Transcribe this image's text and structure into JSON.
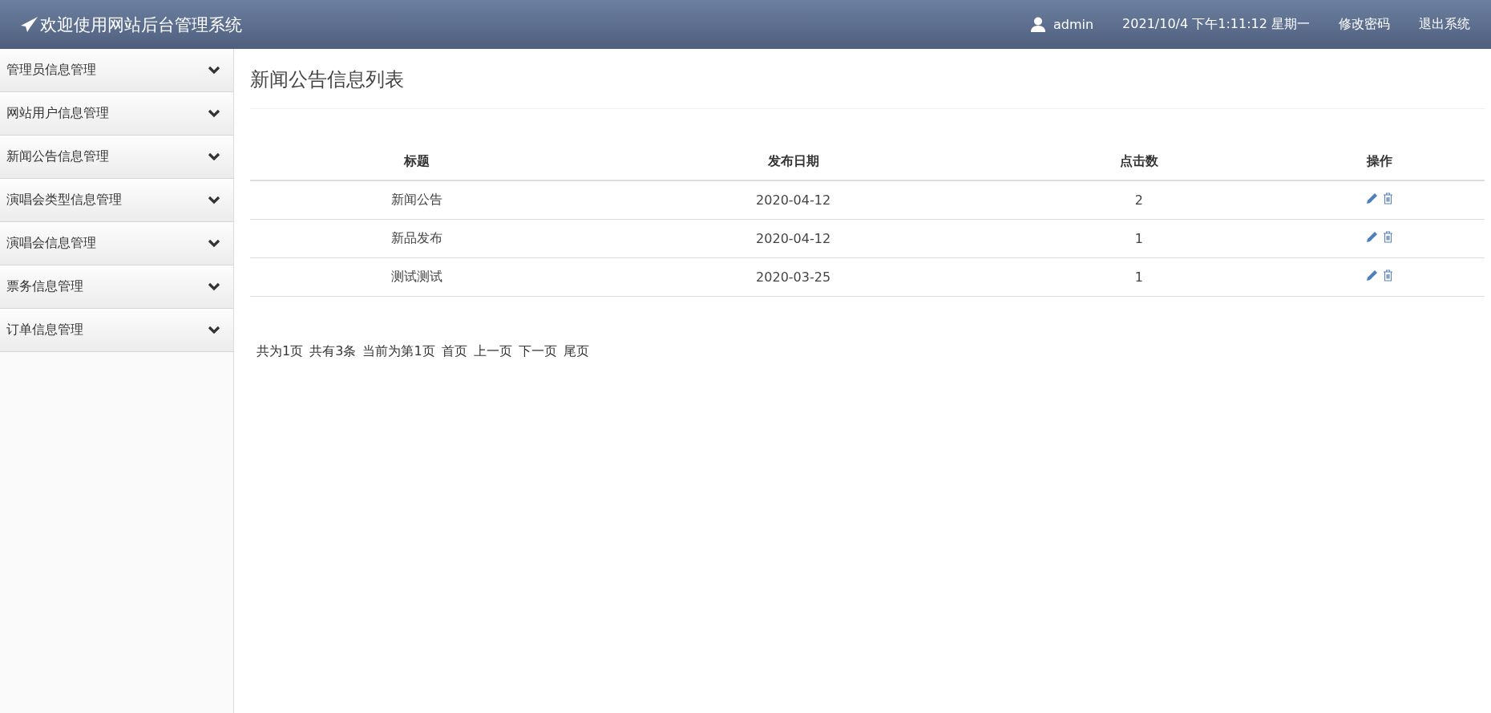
{
  "header": {
    "title": "欢迎使用网站后台管理系统",
    "user": "admin",
    "datetime": "2021/10/4 下午1:11:12 星期一",
    "links": [
      "修改密码",
      "退出系统"
    ]
  },
  "sidebar": {
    "items": [
      {
        "label": "管理员信息管理",
        "expanded": false
      },
      {
        "label": "网站用户信息管理",
        "expanded": false
      },
      {
        "label": "新闻公告信息管理",
        "expanded": false
      },
      {
        "label": "演唱会类型信息管理",
        "expanded": false
      },
      {
        "label": "演唱会信息管理",
        "expanded": false
      },
      {
        "label": "票务信息管理",
        "expanded": false
      },
      {
        "label": "订单信息管理",
        "expanded": false
      }
    ]
  },
  "page_title": "新闻公告信息列表",
  "table": {
    "columns": [
      "标题",
      "发布日期",
      "点击数",
      "操作"
    ],
    "rows": [
      [
        "新闻公告",
        "2020-04-12",
        "2"
      ],
      [
        "新品发布",
        "2020-04-12",
        "1"
      ],
      [
        "测试测试",
        "2020-03-25",
        "1"
      ]
    ]
  },
  "pagination": {
    "info": [
      "共为1页",
      "共有3条",
      "当前为第1页"
    ],
    "links": [
      "首页",
      "上一页",
      "下一页",
      "尾页"
    ]
  }
}
